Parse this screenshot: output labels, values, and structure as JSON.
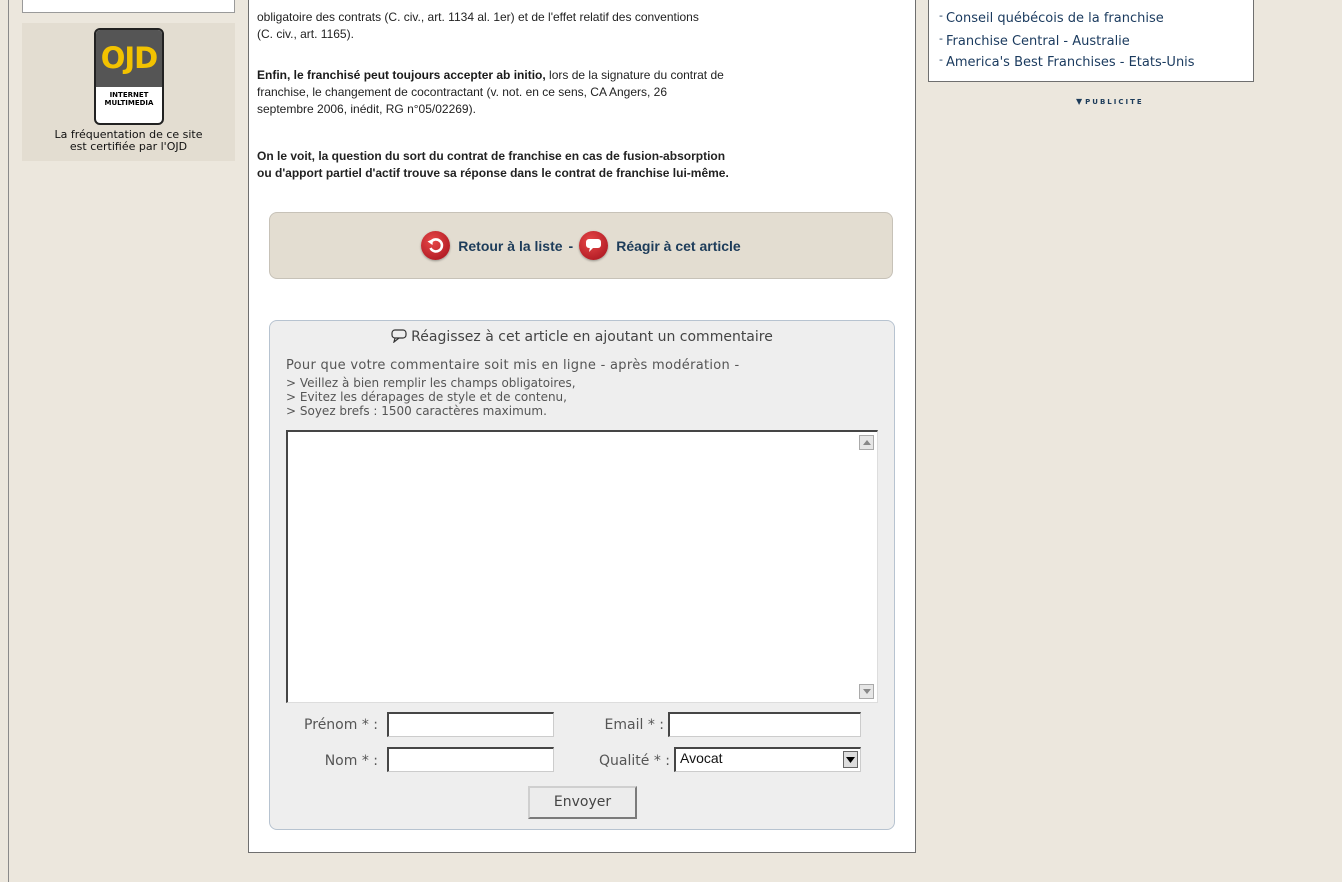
{
  "left_sidebar": {
    "ojd_logo": "OJD",
    "ojd_subtitle_line1": "INTERNET",
    "ojd_subtitle_line2": "MULTIMEDIA",
    "caption_line1": "La fréquentation de ce site",
    "caption_line2": "est certifiée par l'OJD"
  },
  "article": {
    "para1_line1": "obligatoire des contrats (C. civ., art. 1134 al. 1er) et de l'effet relatif des conventions",
    "para1_line2": "(C. civ., art. 1165).",
    "para2_bold": "Enfin, le franchisé peut toujours accepter ab initio,",
    "para2_rest_line1": " lors de la signature du contrat de",
    "para2_line2": "franchise, le changement de cocontractant (v. not. en ce sens, CA Angers, 26",
    "para2_line3": "septembre 2006, inédit, RG n°05/02269).",
    "para3_line1": "On le voit, la question du sort du contrat de franchise en cas de fusion-absorption",
    "para3_line2": "ou d'apport partiel d'actif trouve sa réponse dans le contrat de franchise lui-même."
  },
  "actions": {
    "back_label": "Retour à la liste",
    "separator": "-",
    "react_label": "Réagir à cet article"
  },
  "comment_form": {
    "title": "Réagissez à cet article en ajoutant un commentaire",
    "intro": "Pour que votre commentaire soit mis en ligne - après modération -",
    "rules": [
      "> Veillez à bien remplir les champs obligatoires,",
      "> Evitez les dérapages de style et de contenu,",
      "> Soyez brefs : 1500 caractères maximum."
    ],
    "firstname_label": "Prénom * :",
    "email_label": "Email * :",
    "lastname_label": "Nom * :",
    "quality_label": "Qualité * :",
    "quality_selected": "Avocat",
    "submit_label": "Envoyer"
  },
  "right_sidebar": {
    "links": [
      "Conseil québécois de la franchise",
      "Franchise Central - Australie",
      "America's Best Franchises - Etats-Unis"
    ],
    "ad_label": "PUBLICITE"
  }
}
